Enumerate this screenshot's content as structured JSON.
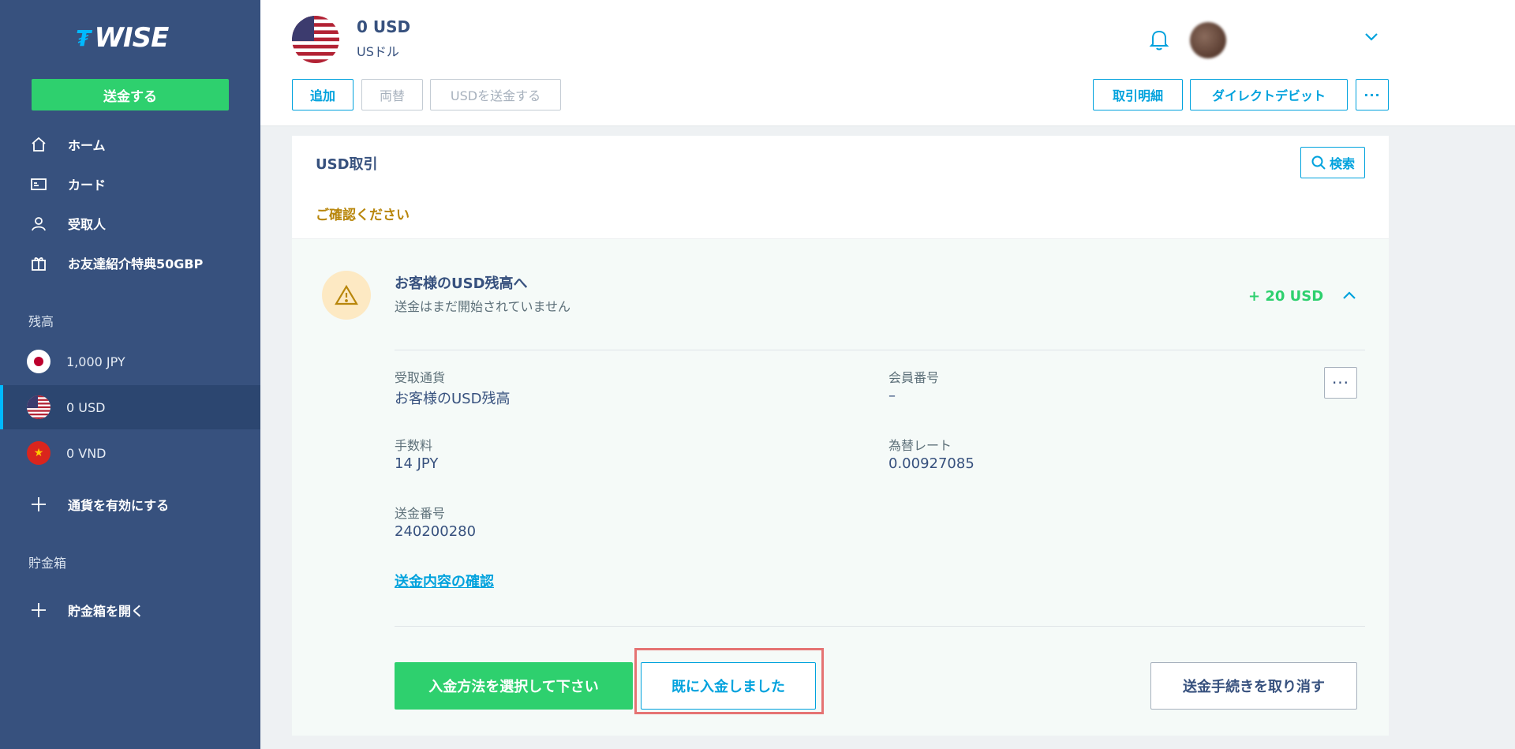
{
  "sidebar": {
    "logo_mark": "₮",
    "logo_word": "WISE",
    "send_label": "送金する",
    "nav": [
      {
        "label": "ホーム",
        "icon": "home-icon"
      },
      {
        "label": "カード",
        "icon": "card-icon"
      },
      {
        "label": "受取人",
        "icon": "person-icon"
      },
      {
        "label": "お友達紹介特典50GBP",
        "icon": "gift-icon"
      }
    ],
    "balances_heading": "残高",
    "balances": [
      {
        "label": "1,000 JPY",
        "flag": "japan-flag"
      },
      {
        "label": "0 USD",
        "flag": "us-flag",
        "active": true
      },
      {
        "label": "0 VND",
        "flag": "vietnam-flag"
      }
    ],
    "add_currency_label": "通貨を有効にする",
    "jars_heading": "貯金箱",
    "open_jar_label": "貯金箱を開く"
  },
  "header": {
    "amount": "0 USD",
    "currency_name": "USドル",
    "add_label": "追加",
    "convert_label": "両替",
    "send_usd_label": "USDを送金する",
    "statements_label": "取引明細",
    "direct_debit_label": "ダイレクトデビット",
    "more_label": "···"
  },
  "transactions": {
    "title": "USD取引",
    "search_label": "検索",
    "attention_label": "ご確認ください",
    "item": {
      "title": "お客様のUSD残高へ",
      "subtitle": "送金はまだ開始されていません",
      "amount": "+ 20 USD",
      "fields": {
        "recipient_currency_label": "受取通貨",
        "recipient_currency_value": "お客様のUSD残高",
        "member_no_label": "会員番号",
        "member_no_value": "–",
        "fee_label": "手数料",
        "fee_value": "14 JPY",
        "rate_label": "為替レート",
        "rate_value": "0.00927085",
        "transfer_no_label": "送金番号",
        "transfer_no_value": "240200280"
      },
      "details_link": "送金内容の確認",
      "pay_method_label": "入金方法を選択して下さい",
      "already_paid_label": "既に入金しました",
      "cancel_label": "送金手続きを取り消す"
    }
  },
  "colors": {
    "sidebar_bg": "#37517e",
    "accent_green": "#2ed06e",
    "accent_blue": "#00a2dd",
    "warning": "#b8860b",
    "highlight_box": "#e57373"
  }
}
